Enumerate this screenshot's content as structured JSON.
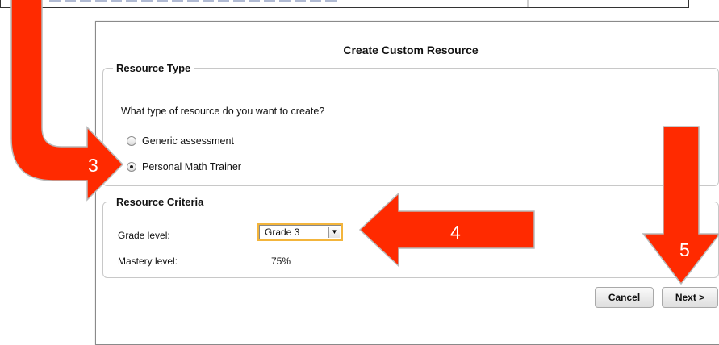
{
  "dialog": {
    "title": "Create Custom Resource",
    "resource_type": {
      "legend": "Resource Type",
      "question": "What type of resource do you want to create?",
      "options": [
        {
          "label": "Generic assessment",
          "selected": false
        },
        {
          "label": "Personal Math Trainer",
          "selected": true
        }
      ]
    },
    "resource_criteria": {
      "legend": "Resource Criteria",
      "grade_label": "Grade level:",
      "grade_value": "Grade 3",
      "mastery_label": "Mastery level:",
      "mastery_value": "75%"
    },
    "buttons": {
      "cancel": "Cancel",
      "next": "Next >"
    }
  },
  "callouts": {
    "step3": "3",
    "step4": "4",
    "step5": "5"
  },
  "colors": {
    "arrow": "#ff2a00",
    "arrow_outline": "#b9b9b9",
    "grade_highlight": "#f3b53c"
  }
}
